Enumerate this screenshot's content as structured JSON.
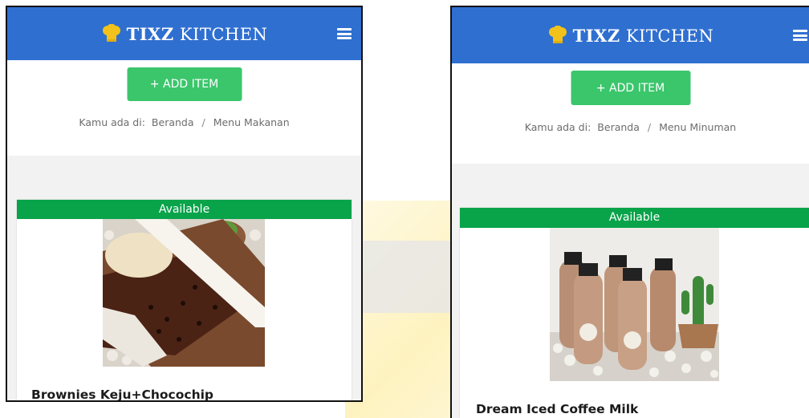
{
  "screens": [
    {
      "brand_bold": "TIXZ",
      "brand_rest": "KITCHEN",
      "add_item_label": "+ ADD ITEM",
      "breadcrumb_prefix": "Kamu ada di:",
      "breadcrumb_home": "Beranda",
      "breadcrumb_sep": "/",
      "breadcrumb_current": "Menu Makanan",
      "card": {
        "status": "Available",
        "title": "Brownies Keju+Chocochip"
      }
    },
    {
      "brand_bold": "TIXZ",
      "brand_rest": "KITCHEN",
      "add_item_label": "+ ADD ITEM",
      "breadcrumb_prefix": "Kamu ada di:",
      "breadcrumb_home": "Beranda",
      "breadcrumb_sep": "/",
      "breadcrumb_current": "Menu Minuman",
      "card": {
        "status": "Available",
        "title": "Dream Iced Coffee Milk"
      }
    }
  ],
  "icons": {
    "logo": "chef-hat-icon",
    "menu": "hamburger-menu-icon"
  },
  "colors": {
    "header": "#2f6fd0",
    "add_button": "#3bc66c",
    "available_badge": "#09a34a",
    "logo_yellow": "#f2c21b"
  }
}
